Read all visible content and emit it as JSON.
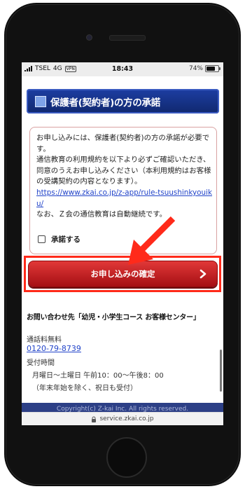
{
  "status_bar": {
    "carrier": "TSEL",
    "network": "4G",
    "vpn": "VPN",
    "time": "18:43",
    "battery": "74%",
    "battery_level": 0.74
  },
  "consent": {
    "section_title": "保護者(契約者)の方の承諾",
    "paragraph": "お申し込みには、保護者(契約者)の方の承諾が必要です。\n通信教育の利用規約を以下より必ずご確認いただき、同意のうえお申し込みください（本利用規約はお客様の受講契約の内容となります）。",
    "terms_link": "https://www.zkai.co.jp/z-app/rule-tsuushinkyouiku/",
    "note": "なお、Ｚ会の通信教育は自動継続です。",
    "checkbox_label": "承諾する",
    "checkbox_checked": false
  },
  "confirm": {
    "label": "お申し込みの確定"
  },
  "contact": {
    "title": "お問い合わせ先「幼児・小学生コース お客様センター」",
    "fee": "通話料無料",
    "phone": "0120-79-8739",
    "hours_label": "受付時間",
    "hours": "月曜日〜土曜日 午前10：00〜午後8：00",
    "hours_note": "（年末年始を除く、祝日も受付）"
  },
  "footer": {
    "copyright": "Copyright(c) Z-kai Inc. All rights reserved."
  },
  "browser": {
    "url": "service.zkai.co.jp"
  },
  "colors": {
    "header_blue": "#1d3ea3",
    "button_red": "#c81e24",
    "highlight_red": "#ff2a1a",
    "link_blue": "#2244c9"
  }
}
